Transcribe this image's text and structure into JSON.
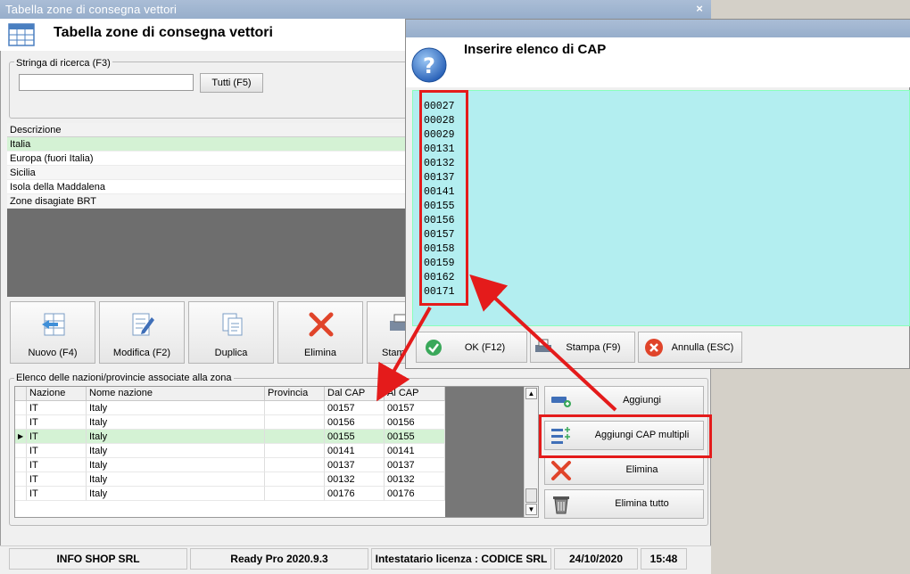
{
  "main_window": {
    "title": "Tabella zone di consegna vettori",
    "close_glyph": "×",
    "header_title": "Tabella zone di consegna vettori"
  },
  "search": {
    "legend": "Stringa di ricerca (F3)",
    "value": "",
    "all_button": "Tutti (F5)"
  },
  "zones": {
    "header": "Descrizione",
    "rows": [
      "Italia",
      "Europa (fuori Italia)",
      "Sicilia",
      "Isola della Maddalena",
      "Zone disagiate BRT"
    ]
  },
  "toolbar": {
    "new": "Nuovo (F4)",
    "edit": "Modifica (F2)",
    "duplicate": "Duplica",
    "delete": "Elimina",
    "print": "Stampa"
  },
  "nations": {
    "legend": "Elenco delle nazioni/provincie associate alla zona",
    "columns": [
      "Nazione",
      "Nome nazione",
      "Provincia",
      "Dal CAP",
      "Al CAP"
    ],
    "rows": [
      [
        "IT",
        "Italy",
        "",
        "00157",
        "00157"
      ],
      [
        "IT",
        "Italy",
        "",
        "00156",
        "00156"
      ],
      [
        "IT",
        "Italy",
        "",
        "00155",
        "00155"
      ],
      [
        "IT",
        "Italy",
        "",
        "00141",
        "00141"
      ],
      [
        "IT",
        "Italy",
        "",
        "00137",
        "00137"
      ],
      [
        "IT",
        "Italy",
        "",
        "00132",
        "00132"
      ],
      [
        "IT",
        "Italy",
        "",
        "00176",
        "00176"
      ]
    ],
    "current_row_marker": "▶"
  },
  "side_buttons": {
    "add": "Aggiungi",
    "add_multiple": "Aggiungi CAP multipli",
    "delete": "Elimina",
    "delete_all": "Elimina tutto"
  },
  "status": {
    "company": "INFO SHOP SRL",
    "version": "Ready Pro 2020.9.3",
    "license": "Intestatario licenza : CODICE SRL",
    "date": "24/10/2020",
    "time": "15:48"
  },
  "dialog": {
    "heading": "Inserire elenco di CAP",
    "cap_list": "00027\n00028\n00029\n00131\n00132\n00137\n00141\n00155\n00156\n00157\n00158\n00159\n00162\n00171",
    "ok": "OK (F12)",
    "print": "Stampa (F9)",
    "cancel": "Annulla (ESC)"
  },
  "colors": {
    "title_bar": "#9fb4d0",
    "selected_row": "#d4f2d4",
    "cap_area": "#b3eef0",
    "highlight": "#e41b1b"
  },
  "icons": [
    "table-icon",
    "question-icon",
    "new-icon",
    "edit-icon",
    "duplicate-icon",
    "delete-x-icon",
    "print-icon",
    "add-icon",
    "add-multiple-icon",
    "trash-icon",
    "check-icon",
    "cancel-icon"
  ]
}
